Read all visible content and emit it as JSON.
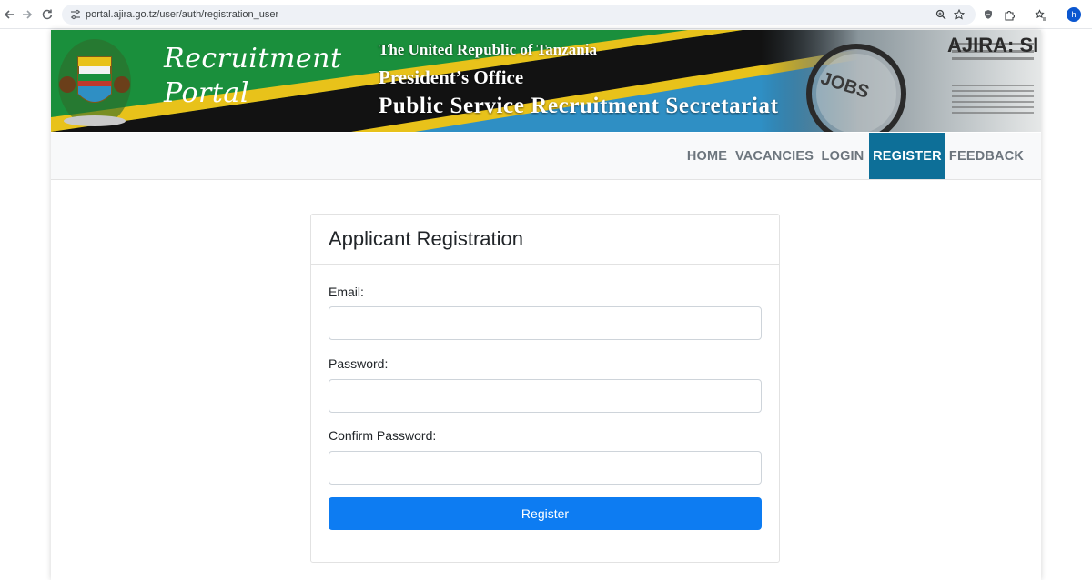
{
  "browser": {
    "url": "portal.ajira.go.tz/user/auth/registration_user",
    "profile_initial": "h"
  },
  "banner": {
    "brand_line1": "Recruitment",
    "brand_line2": "Portal",
    "gov_line1": "The United Republic of Tanzania",
    "gov_line2": "President’s Office",
    "gov_line3": "Public Service Recruitment Secretariat",
    "newspaper_text": "AJIRA: SI",
    "magnifier_text": "JOBS",
    "colors": {
      "green": "#1eb53a",
      "yellow": "#fcd116",
      "black": "#111111",
      "blue": "#00a3dd"
    }
  },
  "nav": {
    "items": [
      {
        "label": "HOME",
        "active": false
      },
      {
        "label": "VACANCIES",
        "active": false
      },
      {
        "label": "LOGIN",
        "active": false
      },
      {
        "label": "REGISTER",
        "active": true
      },
      {
        "label": "FEEDBACK",
        "active": false
      }
    ],
    "active_color": "#0d6f98"
  },
  "form": {
    "title": "Applicant Registration",
    "email_label": "Email:",
    "email_value": "",
    "password_label": "Password:",
    "password_value": "",
    "confirm_label": "Confirm Password:",
    "confirm_value": "",
    "submit_label": "Register",
    "submit_color": "#0d7cf2"
  }
}
